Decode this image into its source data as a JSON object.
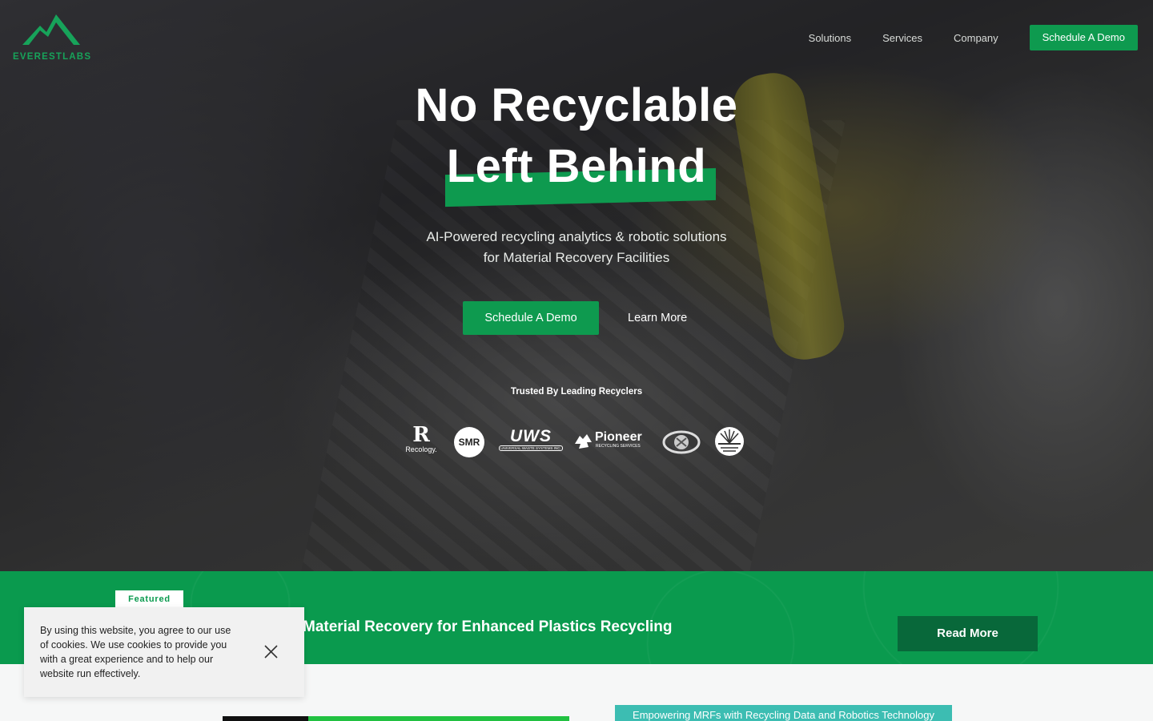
{
  "brand": {
    "name": "EVERESTLABS",
    "accent": "#0e9a4f"
  },
  "nav": {
    "links": [
      "Solutions",
      "Services",
      "Company"
    ],
    "cta": "Schedule A Demo"
  },
  "hero": {
    "headline_line1": "No Recyclable",
    "headline_line2": "Left Behind",
    "subtitle_line1": "AI-Powered recycling analytics & robotic solutions",
    "subtitle_line2": "for Material Recovery Facilities",
    "primary_cta": "Schedule A Demo",
    "secondary_cta": "Learn More",
    "trusted_label": "Trusted By Leading Recyclers"
  },
  "clients": {
    "recology_mark": "R",
    "recology_name": "Recology.",
    "smr": "SMR",
    "uws_mark": "UWS",
    "uws_name": "UNIVERSAL WASTE SYSTEMS INC.",
    "pioneer_mark": "Pioneer",
    "pioneer_name": "RECYCLING SERVICES"
  },
  "featured": {
    "badge": "Featured",
    "title": "Material Recovery for Enhanced Plastics Recycling",
    "cta": "Read More"
  },
  "section": {
    "tag": "Empowering MRFs with Recycling Data and Robotics Technology"
  },
  "cookie": {
    "text": "By using this website, you agree to our use of cookies. We use cookies to provide you with a great experience and to help our website run effectively."
  }
}
